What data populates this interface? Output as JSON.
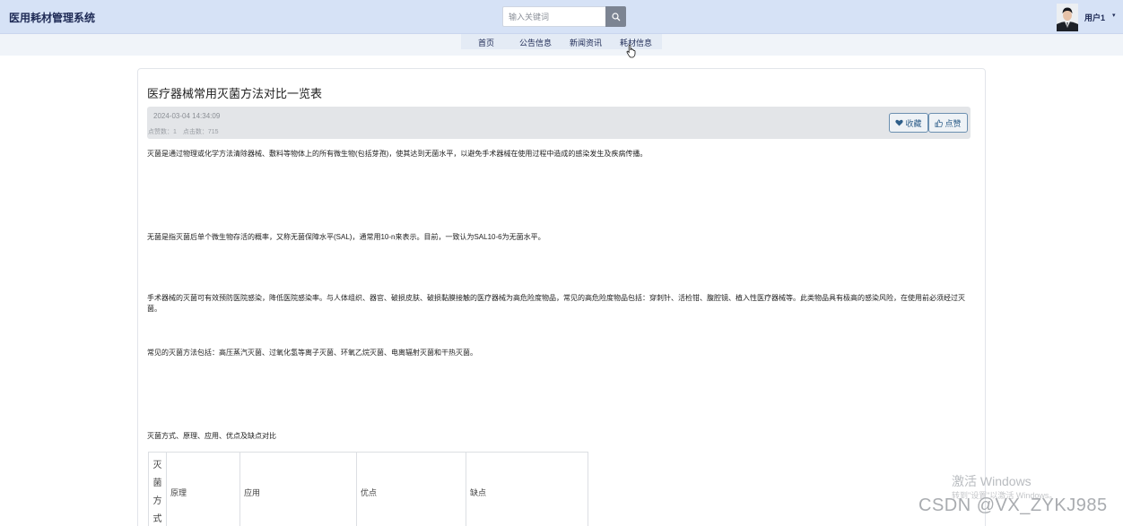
{
  "header": {
    "brand": "医用耗材管理系统",
    "search_placeholder": "输入关键词",
    "user_name": "用户1",
    "user_caret": "▾"
  },
  "nav": {
    "items": [
      {
        "label": "首页"
      },
      {
        "label": "公告信息"
      },
      {
        "label": "新闻资讯"
      },
      {
        "label": "耗材信息"
      }
    ]
  },
  "article": {
    "title": "医疗器械常用灭菌方法对比一览表",
    "date": "2024-03-04 14:34:09",
    "stats": "点赞数：1　点击数：715",
    "fav_label": "收藏",
    "like_label": "点赞",
    "paragraphs": [
      "灭菌是通过物理或化学方法清除器械、敷料等物体上的所有微生物(包括芽孢)，使其达到无菌水平，以避免手术器械在使用过程中造成的感染发生及疾病传播。",
      "无菌是指灭菌后单个微生物存活的概率，又称无菌保障水平(SAL)，通常用10-n来表示。目前，一致认为SAL10-6为无菌水平。",
      "手术器械的灭菌可有效预防医院感染，降低医院感染率。与人体组织、器官、破损皮肤、破损黏膜接触的医疗器械为高危险度物品，常见的高危险度物品包括：穿刺针、活检钳、腹腔镜、植入性医疗器械等。此类物品具有极高的感染风险，在使用前必须经过灭菌。",
      "常见的灭菌方法包括：高压蒸汽灭菌、过氧化氢等离子灭菌、环氧乙烷灭菌、电离辐射灭菌和干热灭菌。",
      "灭菌方式、原理、应用、优点及缺点对比"
    ],
    "table_headers": [
      "灭菌方式",
      "原理",
      "应用",
      "优点",
      "缺点"
    ]
  },
  "overlay": {
    "activate_title": "激活 Windows",
    "activate_sub": "转到\"设置\"以激活 Windows。",
    "csdn": "CSDN @VX_ZYKJ985"
  }
}
